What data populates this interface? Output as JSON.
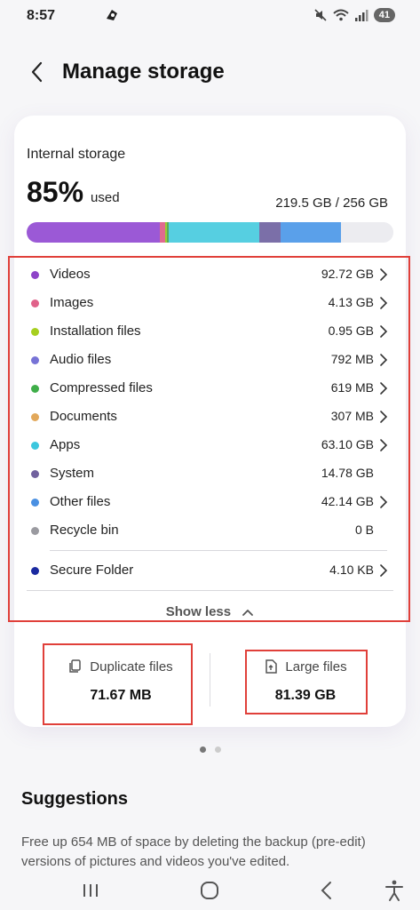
{
  "status_bar": {
    "time": "8:57",
    "battery": "41"
  },
  "header": {
    "title": "Manage storage"
  },
  "storage": {
    "label": "Internal storage",
    "percent": "85%",
    "used_label": "used",
    "capacity": "219.5 GB / 256 GB",
    "bar_segments": [
      {
        "color": "#9b59d6",
        "fraction": 0.362
      },
      {
        "color": "#e06a8f",
        "fraction": 0.016
      },
      {
        "color": "#9acd32",
        "fraction": 0.004
      },
      {
        "color": "#5aaa5a",
        "fraction": 0.006
      },
      {
        "color": "#56cfe1",
        "fraction": 0.247
      },
      {
        "color": "#7b6fa8",
        "fraction": 0.058
      },
      {
        "color": "#5aa0ea",
        "fraction": 0.165
      },
      {
        "color": "#ececf0",
        "fraction": 0.142
      }
    ]
  },
  "categories": [
    {
      "name": "Videos",
      "size": "92.72 GB",
      "color": "#8e44c8",
      "chevron": true
    },
    {
      "name": "Images",
      "size": "4.13 GB",
      "color": "#e0628a",
      "chevron": true
    },
    {
      "name": "Installation files",
      "size": "0.95 GB",
      "color": "#a6cf1f",
      "chevron": true
    },
    {
      "name": "Audio files",
      "size": "792 MB",
      "color": "#7773d6",
      "chevron": true
    },
    {
      "name": "Compressed files",
      "size": "619 MB",
      "color": "#3fae49",
      "chevron": true
    },
    {
      "name": "Documents",
      "size": "307 MB",
      "color": "#e2a85a",
      "chevron": true
    },
    {
      "name": "Apps",
      "size": "63.10 GB",
      "color": "#3cc7de",
      "chevron": true
    },
    {
      "name": "System",
      "size": "14.78 GB",
      "color": "#71619e",
      "chevron": false
    },
    {
      "name": "Other files",
      "size": "42.14 GB",
      "color": "#4a90e2",
      "chevron": true
    },
    {
      "name": "Recycle bin",
      "size": "0 B",
      "color": "#9a9aa0",
      "chevron": false
    }
  ],
  "secure_folder": {
    "name": "Secure Folder",
    "size": "4.10 KB",
    "color": "#1a2aa0"
  },
  "show_less": "Show less",
  "duplicate": {
    "label": "Duplicate files",
    "value": "71.67 MB"
  },
  "large": {
    "label": "Large files",
    "value": "81.39 GB"
  },
  "pager": {
    "count": 2,
    "active": 0
  },
  "suggestions": {
    "title": "Suggestions",
    "text": "Free up 654 MB of space by deleting the backup (pre-edit) versions of pictures and videos you've edited."
  }
}
